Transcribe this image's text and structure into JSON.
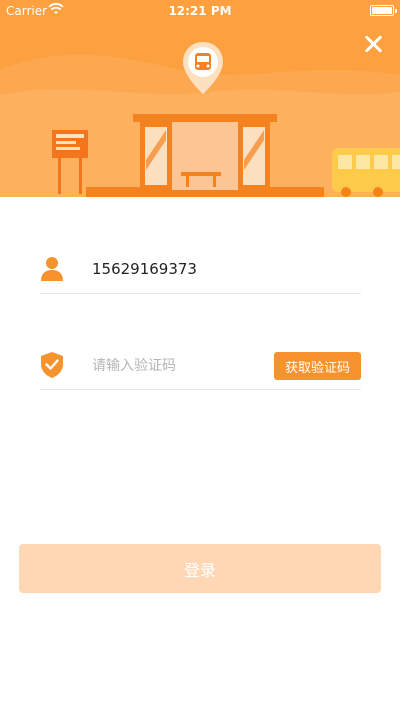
{
  "status_bar": {
    "carrier": "Carrier",
    "time": "12:21 PM"
  },
  "icons": {
    "wifi": "wifi-icon",
    "battery": "battery-icon",
    "close": "close-icon",
    "bus_pin": "bus-location-pin-icon",
    "user": "user-icon",
    "shield": "shield-check-icon"
  },
  "form": {
    "phone": {
      "value": "15629169373"
    },
    "code": {
      "placeholder": "请输入验证码",
      "button_label": "获取验证码"
    }
  },
  "login": {
    "label": "登录"
  },
  "colors": {
    "accent": "#f7932d",
    "login_disabled": "#fed7b5",
    "hero": "#fca040"
  }
}
